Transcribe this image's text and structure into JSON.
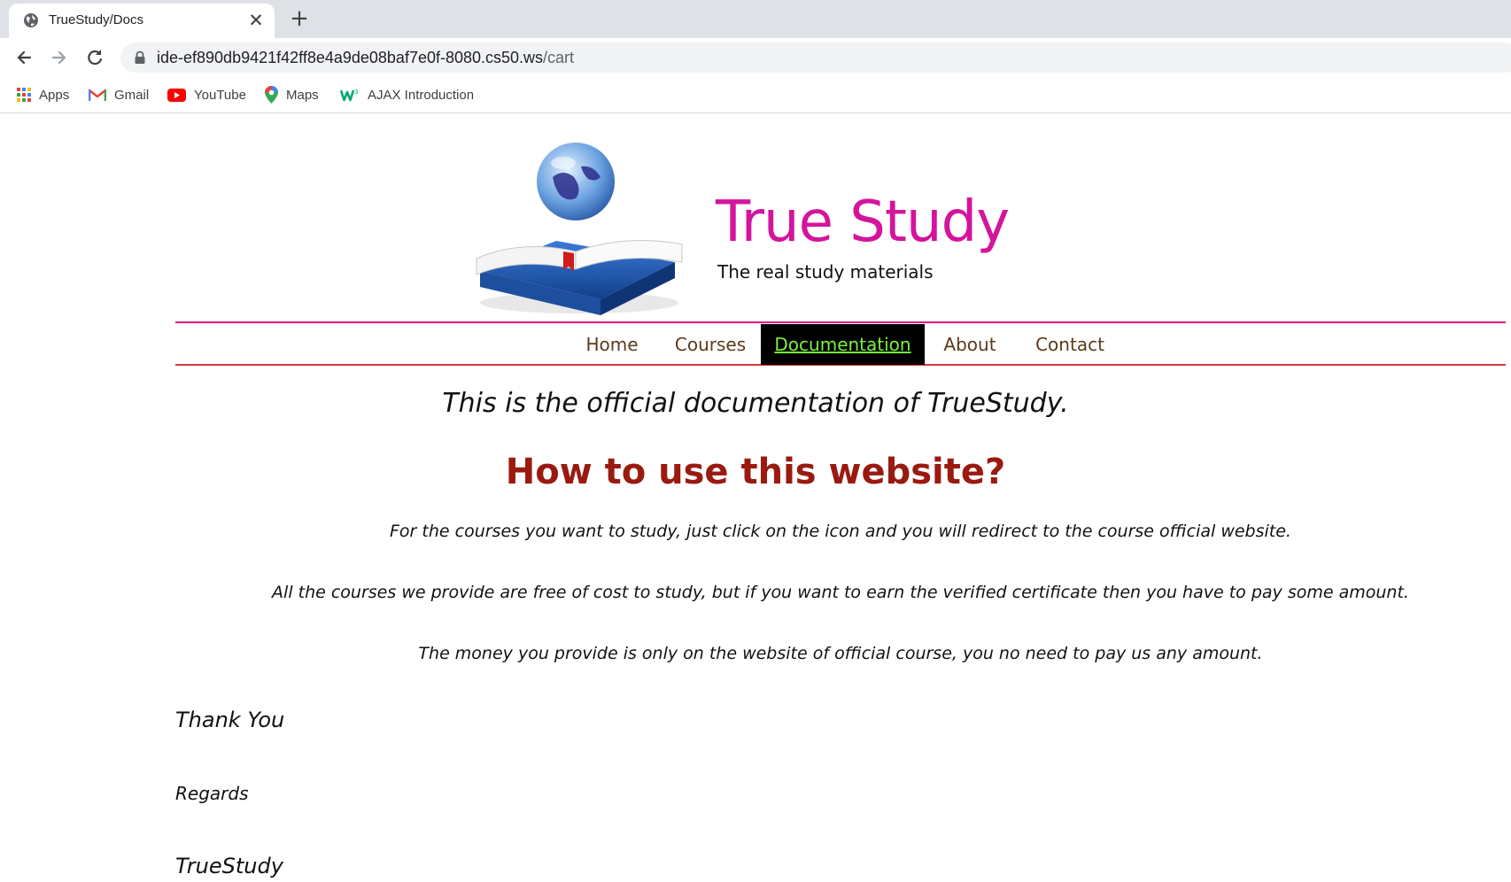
{
  "browser": {
    "tab_title": "TrueStudy/Docs",
    "close_glyph": "✕",
    "new_tab_glyph": "+",
    "url_host": "ide-ef890db9421f42ff8e4a9de08baf7e0f-8080.cs50.ws",
    "url_path": "/cart",
    "bookmarks": [
      {
        "label": "Apps",
        "icon": "apps-grid-icon"
      },
      {
        "label": "Gmail",
        "icon": "gmail-icon"
      },
      {
        "label": "YouTube",
        "icon": "youtube-icon"
      },
      {
        "label": "Maps",
        "icon": "maps-pin-icon"
      },
      {
        "label": "AJAX Introduction",
        "icon": "w3schools-icon"
      }
    ]
  },
  "site": {
    "title": "True Study",
    "tagline": "The real study materials",
    "logo_icon": "globe-book-icon"
  },
  "nav": {
    "items": [
      "Home",
      "Courses",
      "Documentation",
      "About",
      "Contact"
    ],
    "active": "Documentation"
  },
  "content": {
    "intro": "This is the official documentation of TrueStudy.",
    "heading": "How to use this website?",
    "paragraphs": [
      "For the courses you want to study, just click on the icon and you will redirect to the course official website.",
      "All the courses we provide are free of cost to study, but if you want to earn the verified certificate then you have to pay some amount.",
      "The money you provide is only on the website of official course, you no need to pay us any amount."
    ],
    "thanks": "Thank You",
    "regards": "Regards",
    "signature": "TrueStudy"
  },
  "colors": {
    "title": "#d4149c",
    "heading": "#9a1a10",
    "nav_text": "#5a3a1a",
    "nav_active_bg": "#000000",
    "nav_active_text": "#7cf03c",
    "nav_border_top": "#e0147f",
    "nav_border_bottom": "#d83a3a"
  }
}
